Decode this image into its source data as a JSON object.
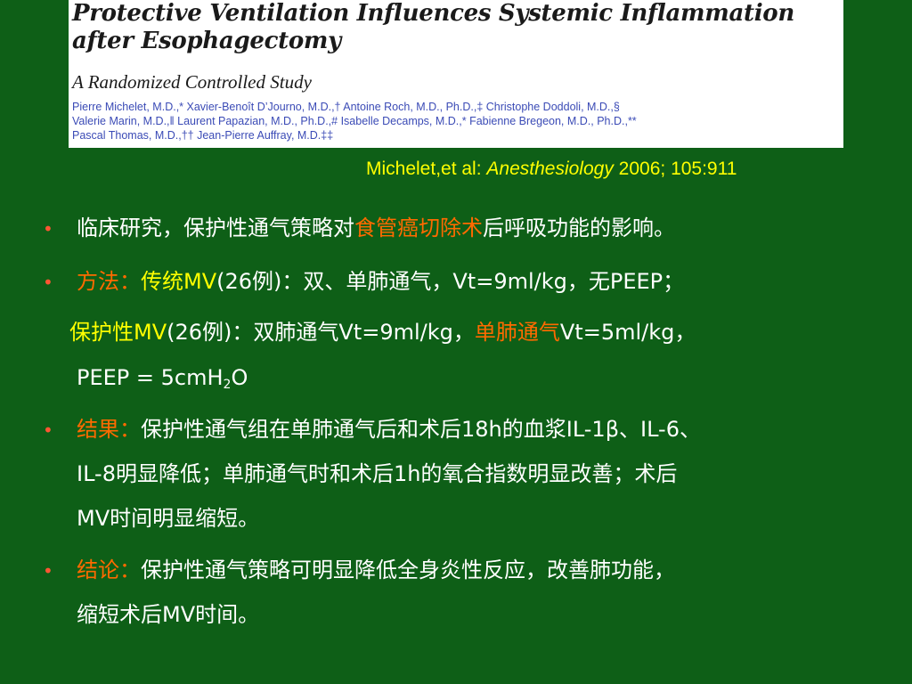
{
  "paper": {
    "title": "Protective Ventilation Influences Systemic Inflammation\nafter Esophagectomy",
    "subtitle": "A Randomized Controlled Study",
    "authors_line1": "Pierre Michelet, M.D.,* Xavier-Benoît D’Journo, M.D.,† Antoine Roch, M.D., Ph.D.,‡ Christophe Doddoli, M.D.,§",
    "authors_line2": "Valerie Marin, M.D.,‖ Laurent Papazian, M.D., Ph.D.,# Isabelle Decamps, M.D.,* Fabienne Bregeon, M.D., Ph.D.,**",
    "authors_line3": "Pascal Thomas, M.D.,†† Jean-Pierre Auffray, M.D.‡‡"
  },
  "citation": {
    "authors": "Michelet,et al: ",
    "journal": "Anesthesiology",
    "ref": " 2006; 105:911"
  },
  "bullet_glyph": "•",
  "intro": {
    "a": "临床研究，保护性通气策略对",
    "hl": "食管癌切除术",
    "b": "后呼吸功能的影响。"
  },
  "methods": {
    "label": "方法：",
    "group1_label": "传统MV",
    "group1_text": "(26例)：双、单肺通气，Vt=9ml/kg，无PEEP；",
    "group2_label": "保护性MV",
    "group2_text_a": "(26例)：双肺通气Vt=9ml/kg，",
    "group2_hl": "单肺通气",
    "group2_text_b": "Vt=5ml/kg，",
    "peep_prefix": "PEEP = 5cmH",
    "peep_sub": "2",
    "peep_suffix": "O"
  },
  "results": {
    "label": "结果：",
    "line1": "保护性通气组在单肺通气后和术后18h的血浆IL-1β、IL-6、",
    "line2": "IL-8明显降低；单肺通气时和术后1h的氧合指数明显改善；术后",
    "line3": "MV时间明显缩短。"
  },
  "conclusion": {
    "label": "结论：",
    "line1": "保护性通气策略可明显降低全身炎性反应，改善肺功能，",
    "line2": "缩短术后MV时间。"
  }
}
